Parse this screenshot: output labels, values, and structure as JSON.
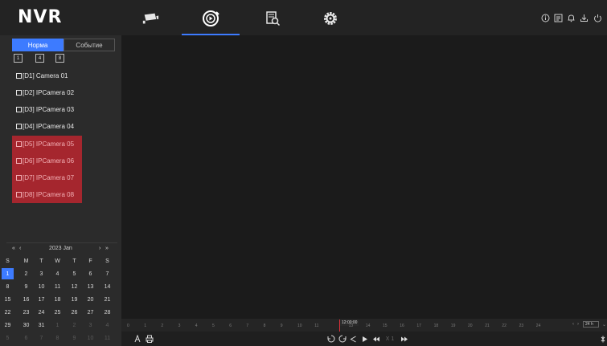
{
  "app": {
    "logo": "NVR"
  },
  "nav": {
    "tabs": [
      {
        "icon": "camera-icon",
        "active": false
      },
      {
        "icon": "playback-icon",
        "active": true
      },
      {
        "icon": "file-search-icon",
        "active": false
      },
      {
        "icon": "settings-gear-icon",
        "active": false
      }
    ],
    "tray": [
      "info-icon",
      "stats-icon",
      "bell-icon",
      "download-icon",
      "power-icon"
    ]
  },
  "sidebar": {
    "tabs": [
      "Норма",
      "Событие"
    ],
    "active_tab": "Норма",
    "split_buttons": [
      "1",
      "4",
      "8"
    ],
    "cameras": [
      {
        "label": "[D1] Camera 01",
        "offline": false
      },
      {
        "label": "[D2] IPCamera 02",
        "offline": false
      },
      {
        "label": "[D3] IPCamera 03",
        "offline": false
      },
      {
        "label": "[D4] IPCamera 04",
        "offline": false
      },
      {
        "label": "[D5] IPCamera 05",
        "offline": true
      },
      {
        "label": "[D6] IPCamera 06",
        "offline": true
      },
      {
        "label": "[D7] IPCamera 07",
        "offline": true
      },
      {
        "label": "[D8] IPCamera 08",
        "offline": true
      }
    ]
  },
  "calendar": {
    "prev_year": "«",
    "prev_month": "‹",
    "title": "2023 Jan",
    "next_month": "›",
    "next_year": "»",
    "weekdays": [
      "S",
      "M",
      "T",
      "W",
      "T",
      "F",
      "S"
    ],
    "weeks": [
      [
        {
          "d": "1",
          "s": "sel"
        },
        {
          "d": "2"
        },
        {
          "d": "3"
        },
        {
          "d": "4"
        },
        {
          "d": "5"
        },
        {
          "d": "6"
        },
        {
          "d": "7"
        }
      ],
      [
        {
          "d": "8"
        },
        {
          "d": "9"
        },
        {
          "d": "10"
        },
        {
          "d": "11"
        },
        {
          "d": "12"
        },
        {
          "d": "13"
        },
        {
          "d": "14"
        }
      ],
      [
        {
          "d": "15"
        },
        {
          "d": "16"
        },
        {
          "d": "17"
        },
        {
          "d": "18"
        },
        {
          "d": "19"
        },
        {
          "d": "20"
        },
        {
          "d": "21"
        }
      ],
      [
        {
          "d": "22"
        },
        {
          "d": "23"
        },
        {
          "d": "24"
        },
        {
          "d": "25"
        },
        {
          "d": "26"
        },
        {
          "d": "27"
        },
        {
          "d": "28"
        }
      ],
      [
        {
          "d": "29"
        },
        {
          "d": "30"
        },
        {
          "d": "31"
        },
        {
          "d": "1",
          "s": "dim"
        },
        {
          "d": "2",
          "s": "dim"
        },
        {
          "d": "3",
          "s": "dim"
        },
        {
          "d": "4",
          "s": "dim"
        }
      ],
      [
        {
          "d": "5",
          "s": "dim"
        },
        {
          "d": "6",
          "s": "dim"
        },
        {
          "d": "7",
          "s": "dim"
        },
        {
          "d": "8",
          "s": "dim"
        },
        {
          "d": "9",
          "s": "dim"
        },
        {
          "d": "10",
          "s": "dim"
        },
        {
          "d": "11",
          "s": "dim"
        }
      ]
    ]
  },
  "timeline": {
    "hours": [
      "0",
      "1",
      "2",
      "3",
      "4",
      "5",
      "6",
      "7",
      "8",
      "9",
      "10",
      "11",
      "12",
      "13",
      "14",
      "15",
      "16",
      "17",
      "18",
      "19",
      "20",
      "21",
      "22",
      "23",
      "24"
    ],
    "current_time": "12:00:00",
    "range": "24 h"
  },
  "controls": {
    "speed": "X 1"
  },
  "colors": {
    "accent": "#3d7bff",
    "offline": "#a5262e"
  }
}
